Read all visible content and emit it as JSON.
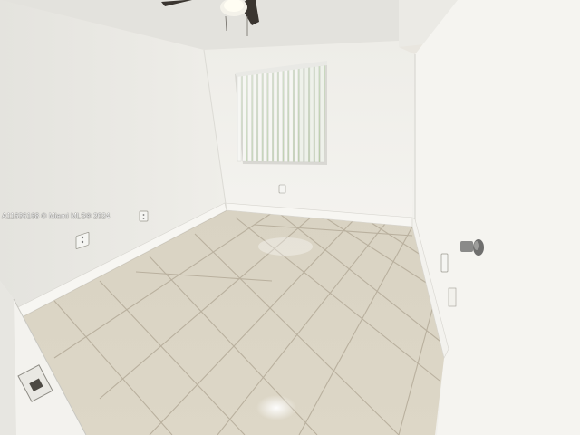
{
  "photo": {
    "watermark": "A11636168 © Miami MLS® 2024",
    "scene": "empty-bedroom"
  },
  "colors": {
    "wall_left": "#ecebe6",
    "wall_back": "#f1f0eb",
    "wall_right": "#f3f2ee",
    "ceiling": "#e2e1dc",
    "floor_tile": "#ddd6c4",
    "grout": "#b7ae9c",
    "baseboard": "#f6f5f1",
    "blinds": "#f4f4f1",
    "knob": "#7c7c7c"
  }
}
